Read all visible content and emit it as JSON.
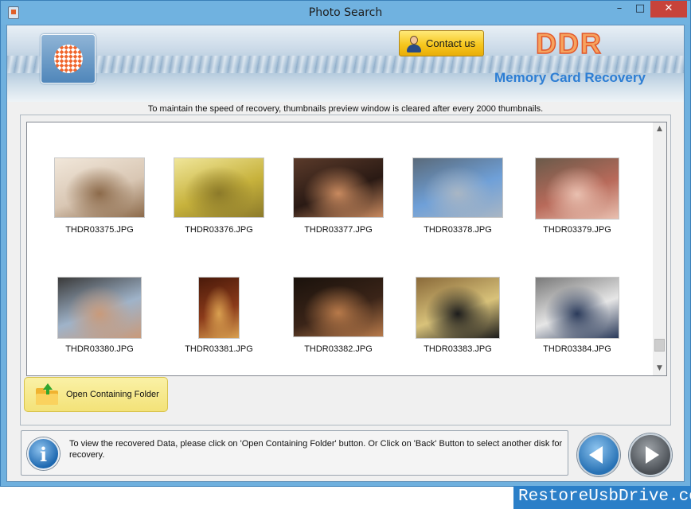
{
  "window": {
    "title": "Photo Search"
  },
  "window_controls": {
    "minimize": "–",
    "maximize": "□",
    "close": "✕"
  },
  "banner": {
    "contact_label": "Contact us",
    "brand_title": "DDR",
    "brand_subtitle": "Memory Card Recovery"
  },
  "notice": "To maintain the speed of recovery, thumbnails preview window is cleared after every 2000 thumbnails.",
  "thumbnails": [
    {
      "name": "THDR03375.JPG",
      "colors": [
        "#d9c7b4",
        "#8c6a4a",
        "#f1e7da"
      ]
    },
    {
      "name": "THDR03376.JPG",
      "colors": [
        "#c7b23c",
        "#8c7a2a",
        "#f0e69a"
      ]
    },
    {
      "name": "THDR03377.JPG",
      "colors": [
        "#2a1a14",
        "#c98a5f",
        "#5a3a2a"
      ]
    },
    {
      "name": "THDR03378.JPG",
      "colors": [
        "#6fa0d8",
        "#a9b6c4",
        "#5a6a7a"
      ]
    },
    {
      "name": "THDR03379.JPG",
      "colors": [
        "#b86a5a",
        "#e9c0b0",
        "#6a5a4a"
      ]
    },
    {
      "name": "THDR03380.JPG",
      "colors": [
        "#9fb3c9",
        "#c99a7a",
        "#3a3a3a"
      ]
    },
    {
      "name": "THDR03381.JPG",
      "colors": [
        "#8a3a1a",
        "#d9a050",
        "#4a1a0a"
      ]
    },
    {
      "name": "THDR03382.JPG",
      "colors": [
        "#3a2418",
        "#b87a4a",
        "#1a120c"
      ]
    },
    {
      "name": "THDR03383.JPG",
      "colors": [
        "#d8c27a",
        "#1c1c1c",
        "#8a6a3a"
      ]
    },
    {
      "name": "THDR03384.JPG",
      "colors": [
        "#e6e6e6",
        "#2a3a5a",
        "#7a7a7a"
      ]
    }
  ],
  "open_folder_label": "Open Containing Folder",
  "info_text": "To view the recovered Data, please click on 'Open Containing Folder' button. Or Click on 'Back' Button to select another disk for recovery.",
  "info_icon_glyph": "i",
  "scroll_up_glyph": "▲",
  "scroll_down_glyph": "▼",
  "watermark": "RestoreUsbDrive.com"
}
